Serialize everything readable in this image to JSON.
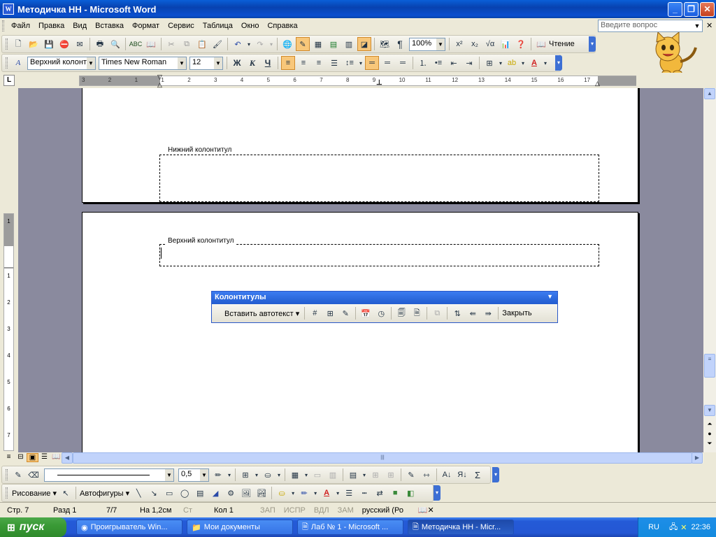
{
  "window": {
    "title": "Методичка НН - Microsoft Word",
    "icon": "word-doc-icon"
  },
  "menu": {
    "items": [
      "Файл",
      "Правка",
      "Вид",
      "Вставка",
      "Формат",
      "Сервис",
      "Таблица",
      "Окно",
      "Справка"
    ],
    "ask_placeholder": "Введите вопрос"
  },
  "standard_toolbar": {
    "zoom": "100%",
    "reading_label": "Чтение"
  },
  "format_toolbar": {
    "style": "Верхний колонт",
    "font": "Times New Roman",
    "size": "12",
    "bold": "Ж",
    "italic": "К",
    "underline": "Ч"
  },
  "ruler": {
    "labels": [
      "3",
      "2",
      "1",
      "1",
      "2",
      "3",
      "4",
      "5",
      "6",
      "7",
      "8",
      "9",
      "10",
      "11",
      "12",
      "13",
      "14",
      "15",
      "16",
      "17"
    ]
  },
  "vruler": {
    "labels": [
      "1",
      "1",
      "2",
      "3",
      "4",
      "5",
      "6",
      "7"
    ]
  },
  "document": {
    "footer_label": "Нижний колонтитул",
    "header_label": "Верхний колонтитул"
  },
  "hf_toolbar": {
    "title": "Колонтитулы",
    "insert_autotext": "Вставить автотекст",
    "close": "Закрыть"
  },
  "drawing_toolbar": {
    "line_weight": "0,5",
    "draw_label": "Рисование",
    "autoshapes_label": "Автофигуры"
  },
  "status": {
    "page": "Стр. 7",
    "section": "Разд 1",
    "pages": "7/7",
    "at": "На 1,2см",
    "line": "Ст",
    "col": "Кол 1",
    "rec": "ЗАП",
    "trk": "ИСПР",
    "ext": "ВДЛ",
    "ovr": "ЗАМ",
    "lang": "русский (Ро"
  },
  "taskbar": {
    "start": "пуск",
    "tasks": [
      "Проигрыватель Win...",
      "Мои документы",
      "Лаб № 1 - Microsoft ...",
      "Методичка НН - Micr..."
    ],
    "lang": "RU",
    "time": "22:36"
  }
}
